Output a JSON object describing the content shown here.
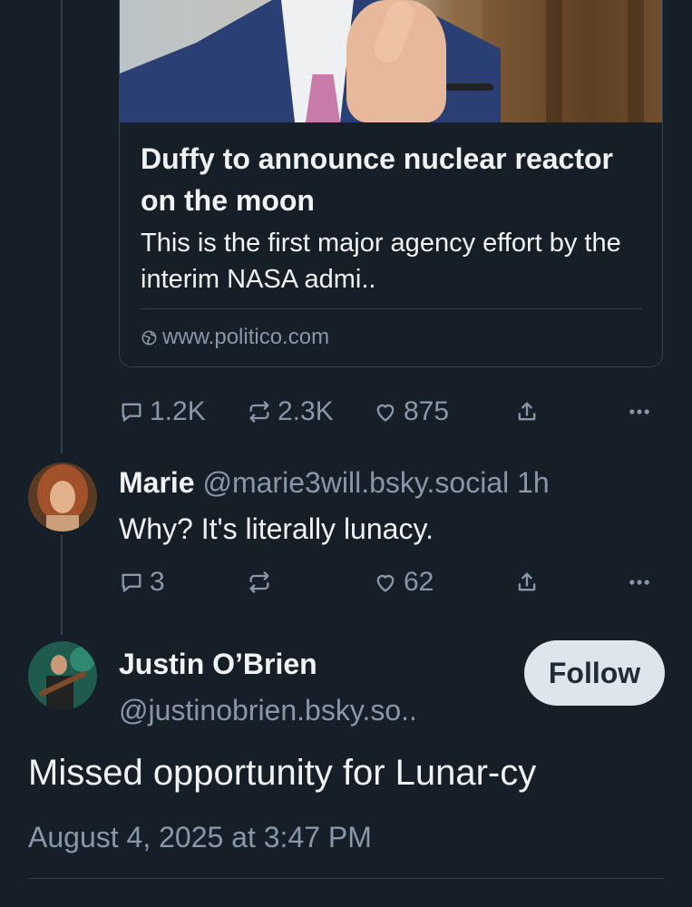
{
  "link_card": {
    "title": "Duffy to announce nuclear reactor on the moon",
    "description": "This is the first major agency effort by the interim NASA admi..",
    "domain": "www.politico.com"
  },
  "post1_actions": {
    "replies": "1.2K",
    "reposts": "2.3K",
    "likes": "875"
  },
  "reply1": {
    "display_name": "Marie",
    "handle": "@marie3will.bsky.social",
    "age": "1h",
    "text": "Why? It's literally lunacy.",
    "replies": "3",
    "reposts": "",
    "likes": "62"
  },
  "main_post": {
    "display_name": "Justin O’Brien",
    "handle": "@justinobrien.bsky.so..",
    "follow_label": "Follow",
    "text": "Missed opportunity for Lunar-cy",
    "timestamp": "August 4, 2025 at 3:47 PM"
  },
  "colors": {
    "background": "#161e27",
    "text": "#f1f3f5",
    "muted": "#8897a9",
    "follow_button": "#dfe5ec"
  },
  "icons": [
    "reply-icon",
    "repost-icon",
    "like-icon",
    "share-icon",
    "more-icon",
    "globe-icon"
  ]
}
